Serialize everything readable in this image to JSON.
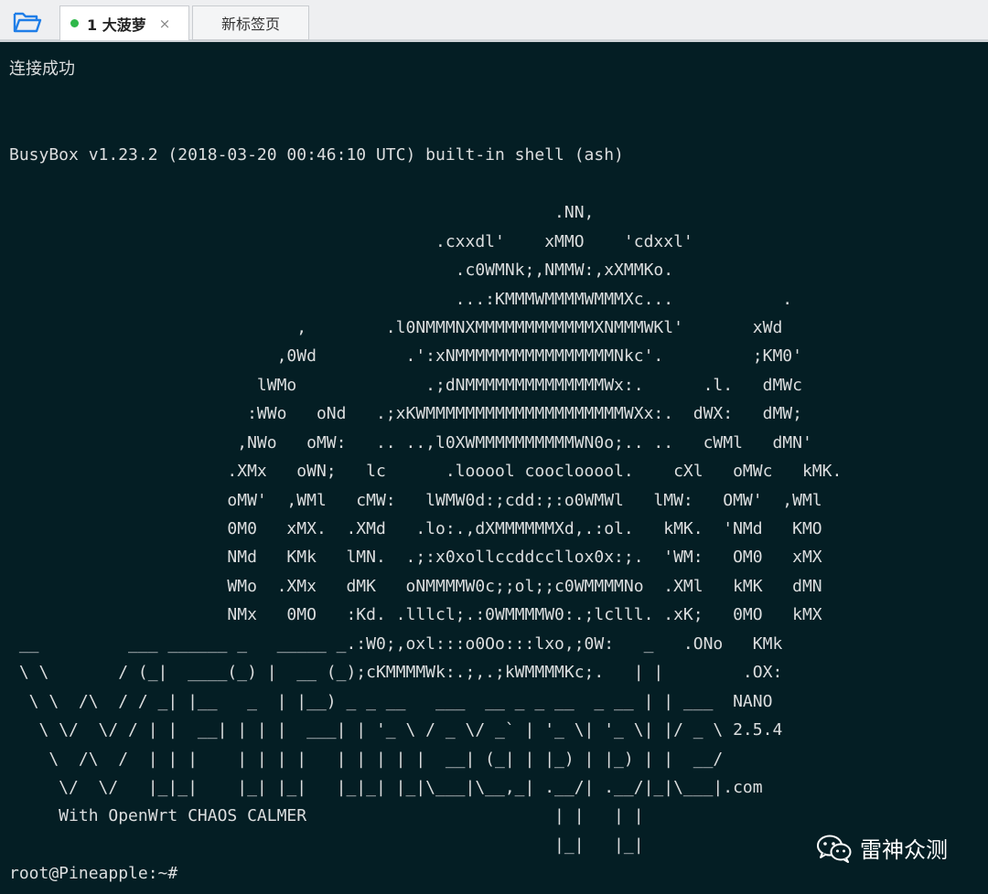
{
  "tabs": [
    {
      "label": "1 大菠萝",
      "active": true,
      "close": "×"
    },
    {
      "label": "新标签页",
      "active": false
    }
  ],
  "terminal": {
    "lines": [
      "连接成功",
      "",
      "",
      "BusyBox v1.23.2 (2018-03-20 00:46:10 UTC) built-in shell (ash)",
      "",
      "                                                       .NN,",
      "                                           .cxxdl'    xMMO    'cdxxl'",
      "                                             .c0WMNk;,NMMW:,xXMMKo.",
      "                                             ...:KMMMWMMMMWMMMXc...           .",
      "                             ,        .l0NMMMNXMMMMMMMMMMMMXNMMMWKl'       xWd",
      "                           ,0Wd         .':xNMMMMMMMMMMMMMMMMNkc'.         ;KM0'",
      "                         lWMo             .;dNMMMMMMMMMMMMMMWx:.      .l.   dMWc",
      "                        :WWo   oNd   .;xKWMMMMMMMMMMMMMMMMMMMMWXx:.  dWX:   dMW;",
      "                       ,NWo   oMW:   .. ..,l0XWMMMMMMMMMMWN0o;.. ..   cWMl   dMN'",
      "                      .XMx   oWN;   lc      .looool cooclooool.    cXl   oMWc   kMK.",
      "                      oMW'  ,WMl   cMW:   lWMW0d:;cdd:;:o0WMWl   lMW:   OMW'  ,WMl",
      "                      0M0   xMX.  .XMd   .lo:.,dXMMMMMMXd,.:ol.   kMK.  'NMd   KMO",
      "                      NMd   KMk   lMN.  .;:x0xollccddccllox0x:;.  'WM:   OM0   xMX",
      "                      WMo  .XMx   dMK   oNMMMMW0c;;ol;;c0WMMMMNo  .XMl   kMK   dMN",
      "                      NMx   0MO   :Kd. .lllcl;.:0WMMMMW0:.;lclll. .xK;   0MO   kMX",
      " __         ___ ______ _   _____ _.:W0;,oxl:::o0Oo:::lxo,;0W:   _   .ONo   KMk",
      " \\ \\       / (_|  ____(_) |  __ (_);cKMMMMWk:.;,.;kWMMMMKc;.   | |        .OX:",
      "  \\ \\  /\\  / / _| |__   _  | |__) _ _ __   ___  __ _ _ __  _ __ | | ___  NANO",
      "   \\ \\/  \\/ / | |  __| | | |  ___| | '_ \\ / _ \\/ _` | '_ \\| '_ \\| |/ _ \\ 2.5.4",
      "    \\  /\\  /  | | |    | | | |   | | | | |  __| (_| | |_) | |_) | |  __/",
      "     \\/  \\/   |_|_|    |_| |_|   |_|_| |_|\\___|\\__,_| .__/| .__/|_|\\___|.com",
      "     With OpenWrt CHAOS CALMER                         | |   | |",
      "                                                       |_|   |_|",
      "root@Pineapple:~#"
    ]
  },
  "watermark": {
    "text": "雷神众测",
    "icon": "wechat-icon"
  },
  "colors": {
    "terminal_bg": "#041e24",
    "terminal_fg": "#dcdedf",
    "status_dot": "#2fb84a",
    "folder_icon": "#1f7ee8"
  }
}
